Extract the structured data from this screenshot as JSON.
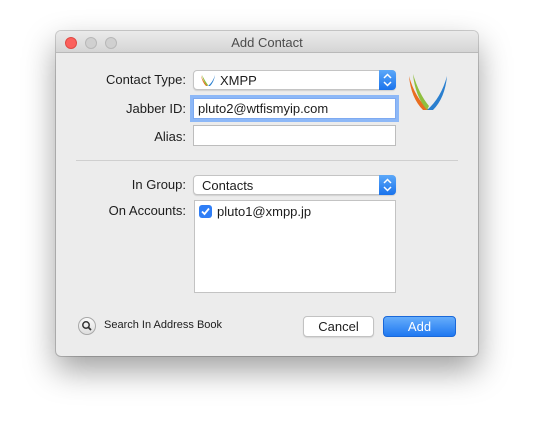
{
  "window": {
    "title": "Add Contact"
  },
  "form": {
    "contact_type_label": "Contact Type:",
    "contact_type_value": "XMPP",
    "jabber_id_label": "Jabber ID:",
    "jabber_id_value": "pluto2@wtfismyip.com",
    "alias_label": "Alias:",
    "alias_value": "",
    "group_label": "In Group:",
    "group_value": "Contacts",
    "accounts_label": "On Accounts:",
    "accounts": [
      {
        "name": "pluto1@xmpp.jp",
        "checked": true
      }
    ]
  },
  "footer": {
    "search_address_book": "Search In Address Book",
    "cancel_label": "Cancel",
    "add_label": "Add"
  },
  "colors": {
    "accent": "#1f78f1",
    "close": "#fc605c",
    "xmpp_orange": "#e96d1f",
    "xmpp_blue": "#2a7fcf",
    "xmpp_green": "#8fbf3f"
  },
  "icons": {
    "protocol": "xmpp-logo-icon",
    "search": "magnifier-icon",
    "checkbox": "checkmark-icon"
  }
}
